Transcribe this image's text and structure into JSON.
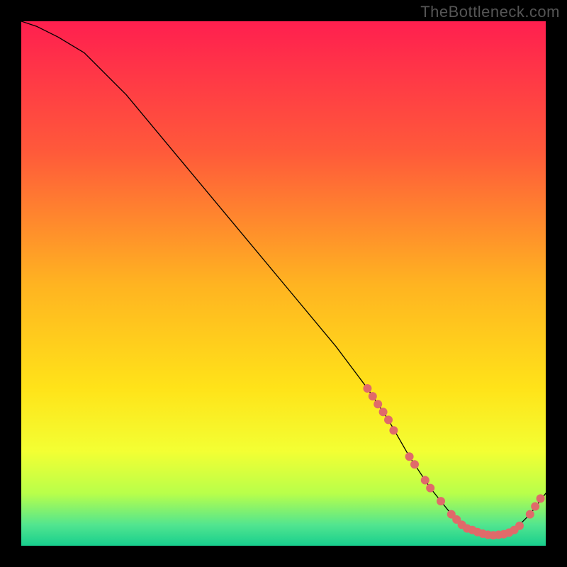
{
  "watermark": "TheBottleneck.com",
  "chart_data": {
    "type": "line",
    "title": "",
    "xlabel": "",
    "ylabel": "",
    "xlim": [
      0,
      100
    ],
    "ylim": [
      0,
      100
    ],
    "grid": false,
    "legend": false,
    "background_gradient": {
      "stops": [
        {
          "pos": 0.0,
          "color": "#ff1f4f"
        },
        {
          "pos": 0.25,
          "color": "#ff5a3a"
        },
        {
          "pos": 0.5,
          "color": "#ffb321"
        },
        {
          "pos": 0.7,
          "color": "#ffe319"
        },
        {
          "pos": 0.82,
          "color": "#f3ff33"
        },
        {
          "pos": 0.9,
          "color": "#b9ff4a"
        },
        {
          "pos": 0.96,
          "color": "#52e58f"
        },
        {
          "pos": 1.0,
          "color": "#18cf8e"
        }
      ]
    },
    "series": [
      {
        "name": "bottleneck-curve",
        "color": "#000000",
        "stroke_width": 1.3,
        "x": [
          0,
          3,
          7,
          12,
          20,
          30,
          40,
          50,
          60,
          66,
          70,
          74,
          78,
          82,
          86,
          90,
          94,
          97,
          100
        ],
        "y": [
          100,
          99,
          97,
          94,
          86,
          74,
          62,
          50,
          38,
          30,
          24,
          17,
          11,
          6,
          3,
          2,
          3,
          6,
          10
        ]
      }
    ],
    "markers": {
      "name": "highlight-dots",
      "color": "#e06a6a",
      "radius": 6,
      "points": [
        {
          "x": 66,
          "y": 30
        },
        {
          "x": 67,
          "y": 28.5
        },
        {
          "x": 68,
          "y": 27
        },
        {
          "x": 69,
          "y": 25.5
        },
        {
          "x": 70,
          "y": 24
        },
        {
          "x": 71,
          "y": 22
        },
        {
          "x": 74,
          "y": 17
        },
        {
          "x": 75,
          "y": 15.5
        },
        {
          "x": 77,
          "y": 12.5
        },
        {
          "x": 78,
          "y": 11
        },
        {
          "x": 80,
          "y": 8.5
        },
        {
          "x": 82,
          "y": 6
        },
        {
          "x": 83,
          "y": 5
        },
        {
          "x": 84,
          "y": 4
        },
        {
          "x": 85,
          "y": 3.3
        },
        {
          "x": 86,
          "y": 3
        },
        {
          "x": 87,
          "y": 2.6
        },
        {
          "x": 88,
          "y": 2.3
        },
        {
          "x": 89,
          "y": 2.1
        },
        {
          "x": 90,
          "y": 2
        },
        {
          "x": 91,
          "y": 2.1
        },
        {
          "x": 92,
          "y": 2.2
        },
        {
          "x": 93,
          "y": 2.5
        },
        {
          "x": 94,
          "y": 3
        },
        {
          "x": 95,
          "y": 3.8
        },
        {
          "x": 97,
          "y": 6
        },
        {
          "x": 98,
          "y": 7.5
        },
        {
          "x": 99,
          "y": 9
        }
      ]
    }
  }
}
